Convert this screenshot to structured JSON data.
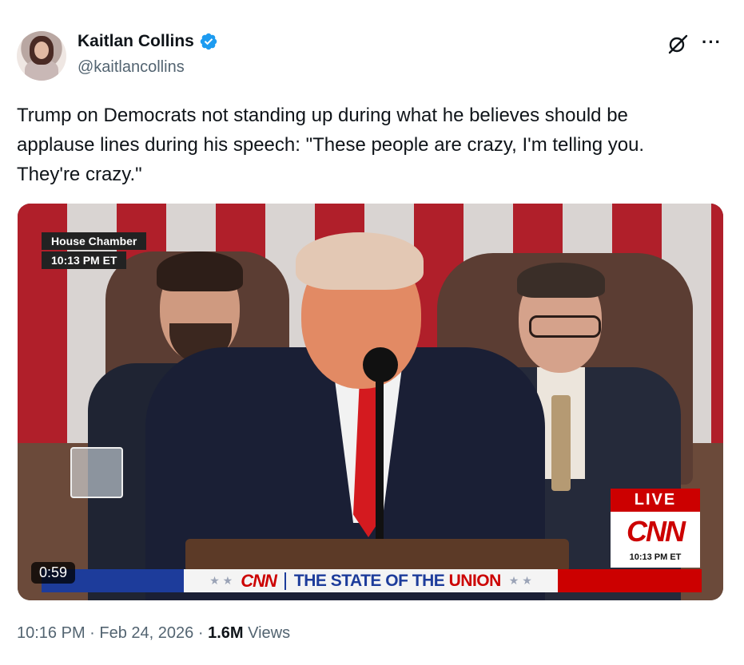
{
  "author": {
    "name": "Kaitlan Collins",
    "handle": "@kaitlancollins",
    "verified": true
  },
  "tweet": {
    "text": "Trump on Democrats not standing up during what he believes should be\napplause lines during his speech: \"These people are crazy, I'm telling you.\nThey're crazy.\""
  },
  "video": {
    "location_tag": "House Chamber",
    "time_tag": "10:13 PM ET",
    "live_label": "LIVE",
    "network_logo": "CNN",
    "network_time": "10:13 PM ET",
    "banner_logo": "CNN",
    "banner_title_part1": "THE STATE OF THE",
    "banner_title_part2": "UNION",
    "duration": "0:59"
  },
  "meta": {
    "time": "10:16 PM",
    "separator": "·",
    "date": "Feb 24, 2026",
    "views_count": "1.6M",
    "views_label": "Views"
  },
  "icons": {
    "verified": "verified-badge-icon",
    "grok": "grok-icon",
    "more": "more-icon"
  },
  "colors": {
    "verified_blue": "#1d9bf0",
    "cnn_red": "#cc0000",
    "secondary_text": "#536471"
  }
}
